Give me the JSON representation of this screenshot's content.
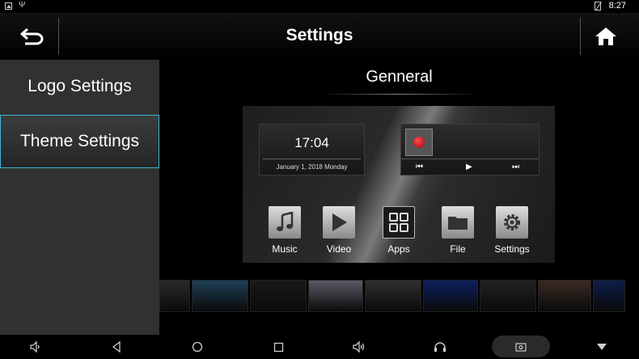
{
  "status_bar": {
    "time": "8:27",
    "icons": [
      "image-icon",
      "usb-icon",
      "no-sim-icon",
      "battery-icon"
    ]
  },
  "title_bar": {
    "title": "Settings",
    "back_icon": "back-arrow-icon",
    "home_icon": "home-icon"
  },
  "sidebar": {
    "items": [
      {
        "label": "Logo Settings",
        "selected": false
      },
      {
        "label": "Theme Settings",
        "selected": true
      }
    ],
    "accent_color": "#3fb6d8"
  },
  "main": {
    "section_title": "Genneral",
    "preview": {
      "clock": {
        "time": "17:04",
        "date": "January 1, 2018  Monday"
      },
      "music_controls": [
        "previous-icon",
        "play-icon",
        "next-icon"
      ],
      "apps": [
        {
          "label": "Music",
          "icon": "music-note-icon"
        },
        {
          "label": "Video",
          "icon": "play-icon"
        },
        {
          "label": "Apps",
          "icon": "grid-icon"
        },
        {
          "label": "File",
          "icon": "folder-icon"
        },
        {
          "label": "Settings",
          "icon": "gear-icon"
        }
      ]
    },
    "theme_thumbnails": [
      {
        "name": "theme-1",
        "color": "#2a2a2a"
      },
      {
        "name": "theme-2",
        "color": "#1f3f57"
      },
      {
        "name": "theme-3",
        "color": "#1a1a1a"
      },
      {
        "name": "theme-4",
        "color": "#5a5a66"
      },
      {
        "name": "theme-5",
        "color": "#303030"
      },
      {
        "name": "theme-6",
        "color": "#0c1f5c"
      },
      {
        "name": "theme-7",
        "color": "#222222"
      },
      {
        "name": "theme-8",
        "color": "#3a2a24"
      },
      {
        "name": "theme-9",
        "color": "#0c1d4a"
      }
    ]
  },
  "nav_bar": {
    "items": [
      "volume-down-icon",
      "back-icon",
      "home-circle-icon",
      "recents-icon",
      "volume-up-icon",
      "headset-icon",
      "screenshot-icon",
      "hide-bar-icon"
    ]
  }
}
